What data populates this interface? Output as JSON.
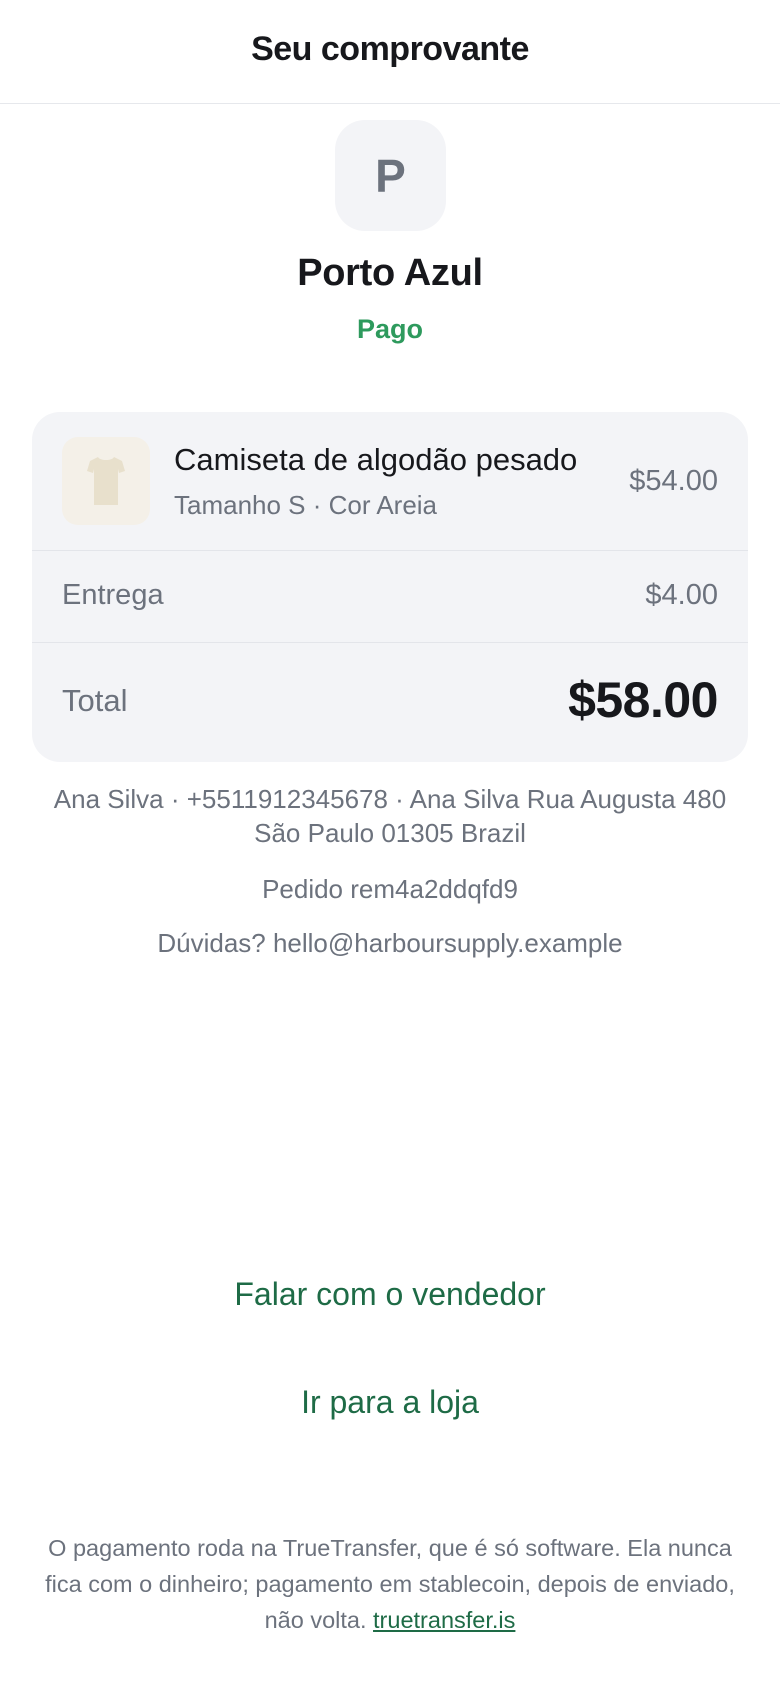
{
  "header": {
    "title": "Seu comprovante"
  },
  "merchant": {
    "initial": "P",
    "name": "Porto Azul",
    "status": "Pago",
    "status_color": "#2e9a5d"
  },
  "order": {
    "item": {
      "name": "Camiseta de algodão pesado",
      "variant": "Tamanho S · Cor Areia",
      "price": "$54.00",
      "thumbnail_icon": "tshirt-icon"
    },
    "shipping": {
      "label": "Entrega",
      "value": "$4.00"
    },
    "total": {
      "label": "Total",
      "value": "$58.00"
    }
  },
  "details": {
    "address_line1": "Ana Silva · +5511912345678 · Ana Silva Rua Augusta 480",
    "address_line2": "São Paulo 01305 Brazil",
    "order_id": "Pedido rem4a2ddqfd9",
    "contact": "Dúvidas? hello@harboursupply.example"
  },
  "actions": {
    "contact_seller": "Falar com o vendedor",
    "go_to_store": "Ir para a loja",
    "accent_color": "#1e6b46"
  },
  "footer": {
    "text": "O pagamento roda na TrueTransfer, que é só software. Ela nunca fica com o dinheiro; pagamento em stablecoin, depois de enviado, não volta.",
    "link_label": "truetransfer.is"
  }
}
